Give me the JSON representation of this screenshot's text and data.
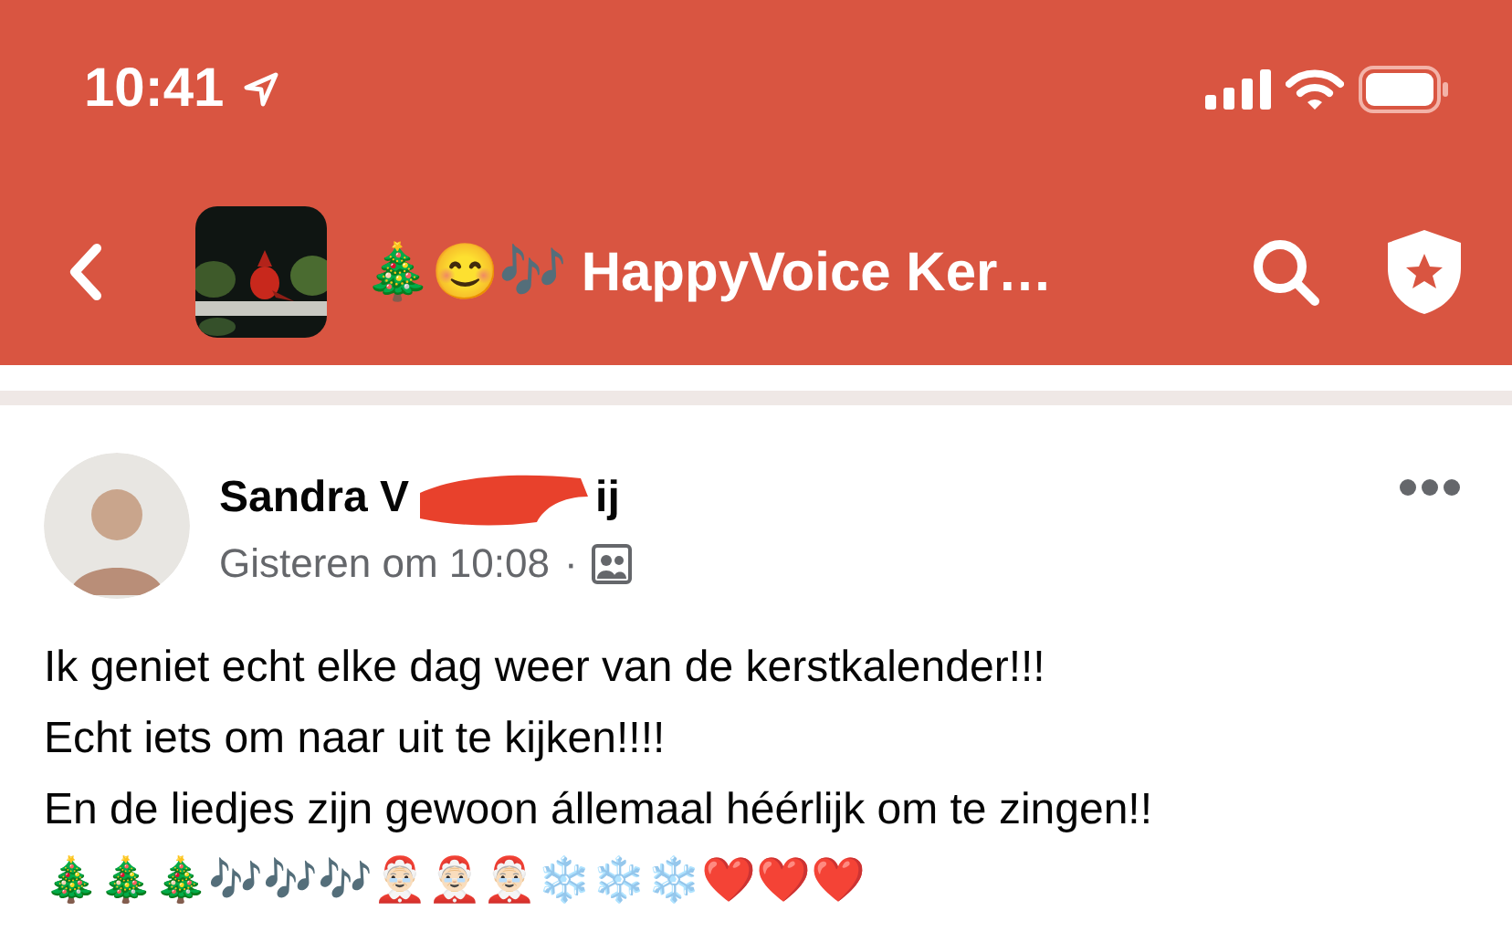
{
  "status_bar": {
    "time": "10:41"
  },
  "header": {
    "title": "🎄😊🎶 HappyVoice Ker…"
  },
  "post": {
    "author_start": "Sandra V",
    "author_end": "ij",
    "redacted": true,
    "time": "Gisteren om 10:08",
    "separator": "·",
    "lines": [
      "Ik geniet echt elke dag weer van de kerstkalender!!!",
      "Echt iets om naar uit te kijken!!!!",
      "En de liedjes zijn gewoon állemaal héérlijk om te zingen!!",
      "🎄🎄🎄🎶🎶🎶🤶🏻🤶🏻🤶🏻❄️❄️❄️❤️❤️❤️"
    ]
  }
}
